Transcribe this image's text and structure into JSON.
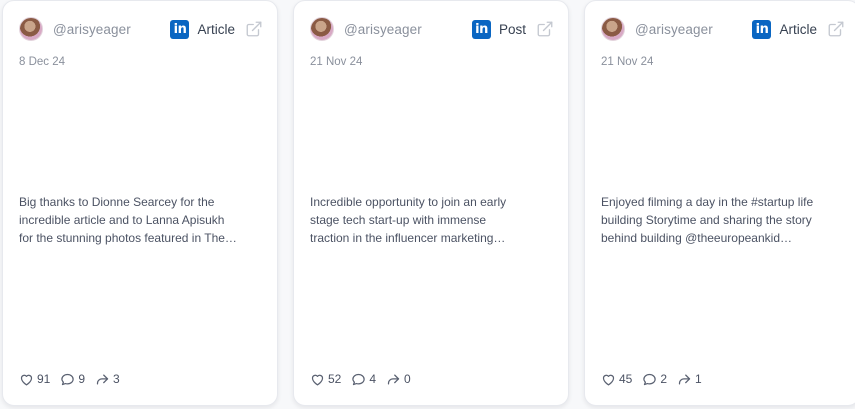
{
  "cards": [
    {
      "handle": "@arisyeager",
      "platform_icon": "linkedin-icon",
      "type": "Article",
      "date": "8 Dec 24",
      "lines": [
        "Big thanks to Dionne Searcey for the",
        "incredible article and to Lanna Apisukh",
        "for the stunning photos featured in The…"
      ],
      "likes": "91",
      "comments": "9",
      "shares": "3"
    },
    {
      "handle": "@arisyeager",
      "platform_icon": "linkedin-icon",
      "type": "Post",
      "date": "21 Nov 24",
      "lines": [
        "Incredible opportunity to join an early",
        "stage tech start-up with immense",
        "traction in the influencer marketing…"
      ],
      "likes": "52",
      "comments": "4",
      "shares": "0"
    },
    {
      "handle": "@arisyeager",
      "platform_icon": "linkedin-icon",
      "type": "Article",
      "date": "21 Nov 24",
      "lines": [
        "Enjoyed filming a day in the #startup life",
        "building Storytime and sharing the story",
        "behind building @theeuropeankid…"
      ],
      "likes": "45",
      "comments": "2",
      "shares": "1"
    }
  ],
  "linkedin_label": "in",
  "colors": {
    "linkedin": "#0a66c2",
    "muted": "#8a909c",
    "text": "#4b5263"
  }
}
